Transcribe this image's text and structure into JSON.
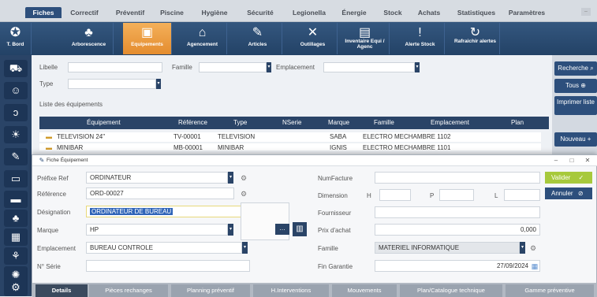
{
  "menu": [
    "Fiches",
    "Correctif",
    "Préventif",
    "Piscine",
    "Hygiène",
    "Sécurité",
    "Legionella",
    "Énergie",
    "Stock",
    "Achats",
    "Statistiques",
    "Paramètres"
  ],
  "toolbar": [
    {
      "label": "T. Bord",
      "icon": "dashboard-icon"
    },
    {
      "label": "Arborescence",
      "icon": "tree-icon"
    },
    {
      "label": "Equipements",
      "icon": "equipment-icon"
    },
    {
      "label": "Agencement",
      "icon": "bed-icon"
    },
    {
      "label": "Articles",
      "icon": "wrench-icon"
    },
    {
      "label": "Outillages",
      "icon": "tools-icon"
    },
    {
      "label": "Inventaire Equi / Agenc",
      "icon": "inventory-icon"
    },
    {
      "label": "Alerte Stock",
      "icon": "alert-icon"
    },
    {
      "label": "Rafraichir alertes",
      "icon": "refresh-icon"
    }
  ],
  "filters": {
    "libelle": "Libelle",
    "famille": "Famille",
    "emplacement": "Emplacement",
    "type": "Type",
    "list_title": "Liste des équipements"
  },
  "grid": {
    "headers": [
      "Équipement",
      "Référence",
      "Type",
      "NSerie",
      "Marque",
      "Famille",
      "Emplacement",
      "Plan"
    ],
    "rows": [
      [
        "TELEVISION 24\"",
        "TV-00001",
        "TELEVISION",
        "",
        "SABA",
        "ELECTRO ME",
        "CHAMBRE 1102",
        ""
      ],
      [
        "MINIBAR",
        "MB-00001",
        "MINIBAR",
        "",
        "IGNIS",
        "ELECTRO ME",
        "CHAMBRE 1101",
        ""
      ]
    ]
  },
  "right_buttons": {
    "recherche": "Recherche",
    "tous": "Tous",
    "imprimer": "Imprimer liste",
    "nouveau": "Nouveau"
  },
  "modal": {
    "title": "Fiche Équipement",
    "prefixe_label": "Préfixe Ref",
    "prefixe_value": "ORDINATEUR",
    "reference_label": "Référence",
    "reference_value": "ORD-00027",
    "designation_label": "Désignation",
    "designation_value": "ORDINATEUR DE BUREAU",
    "marque_label": "Marque",
    "marque_value": "HP",
    "emplacement_label": "Emplacement",
    "emplacement_value": "BUREAU CONTROLE",
    "nserie_label": "N° Série",
    "nserie_value": "",
    "numfacture_label": "NumFacture",
    "numfacture_value": "",
    "dimension_label": "Dimension",
    "h_label": "H",
    "p_label": "P",
    "l_label": "L",
    "fournisseur_label": "Fournisseur",
    "fournisseur_value": "",
    "prix_label": "Prix d'achat",
    "prix_value": "0,000",
    "famille_label": "Famille",
    "famille_value": "MATERIEL INFORMATIQUE",
    "fingarantie_label": "Fin Garantie",
    "fingarantie_value": "27/09/2024",
    "valider": "Valider",
    "annuler": "Annuler",
    "tabs": [
      "Details",
      "Pièces rechanges",
      "Planning préventif",
      "H.Interventions",
      "Mouvements",
      "Plan/Catalogue technique",
      "Gamme préventive"
    ]
  }
}
